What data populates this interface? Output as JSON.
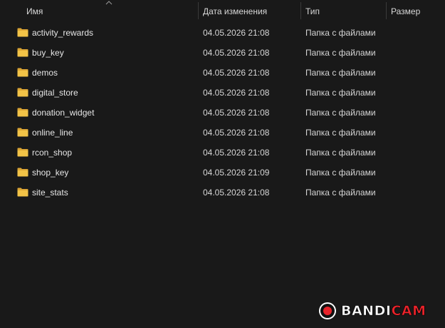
{
  "columns": {
    "name": "Имя",
    "date": "Дата изменения",
    "type": "Тип",
    "size": "Размер"
  },
  "files": [
    {
      "name": "activity_rewards",
      "date": "04.05.2026 21:08",
      "type": "Папка с файлами",
      "icon": "folder-icon"
    },
    {
      "name": "buy_key",
      "date": "04.05.2026 21:08",
      "type": "Папка с файлами",
      "icon": "folder-icon"
    },
    {
      "name": "demos",
      "date": "04.05.2026 21:08",
      "type": "Папка с файлами",
      "icon": "folder-icon"
    },
    {
      "name": "digital_store",
      "date": "04.05.2026 21:08",
      "type": "Папка с файлами",
      "icon": "folder-icon"
    },
    {
      "name": "donation_widget",
      "date": "04.05.2026 21:08",
      "type": "Папка с файлами",
      "icon": "folder-icon"
    },
    {
      "name": "online_line",
      "date": "04.05.2026 21:08",
      "type": "Папка с файлами",
      "icon": "folder-icon"
    },
    {
      "name": "rcon_shop",
      "date": "04.05.2026 21:08",
      "type": "Папка с файлами",
      "icon": "folder-icon"
    },
    {
      "name": "shop_key",
      "date": "04.05.2026 21:09",
      "type": "Папка с файлами",
      "icon": "folder-icon"
    },
    {
      "name": "site_stats",
      "date": "04.05.2026 21:08",
      "type": "Папка с файлами",
      "icon": "folder-icon"
    }
  ],
  "watermark": {
    "text_main": "BANDI",
    "text_accent": "CAM",
    "accent_color": "#e8232a"
  },
  "colors": {
    "background": "#191919",
    "folder": "#f2c347"
  }
}
